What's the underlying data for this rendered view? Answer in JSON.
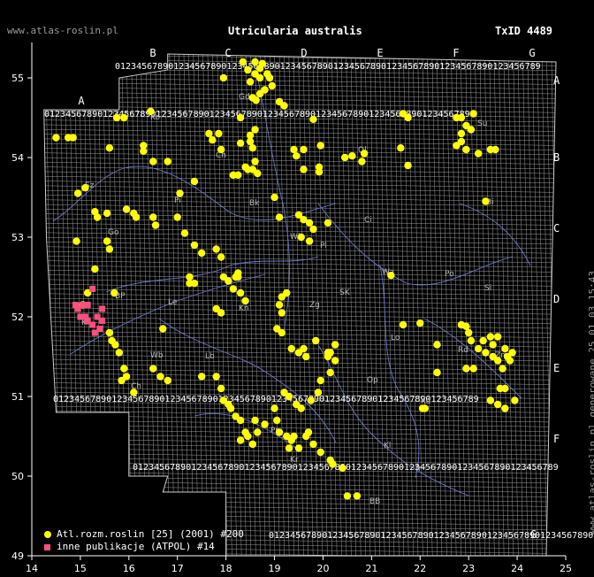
{
  "header": {
    "site": "www.atlas-roslin.pl",
    "title": "Utricularia australis",
    "taxid": "TxID 4489"
  },
  "side_text": "www.atlas-roslin.pl generowane 25.01.03 15:43",
  "legend": {
    "atlas_label": "Atl.rozm.roslin [25] (2001) #200",
    "atpol_label": "inne publikacje (ATPOL) #14"
  },
  "colors": {
    "atlas_dot": "#ffff00",
    "atpol_square": "#ff4f7f",
    "grid": "#ffffff",
    "rivers": "#6a78c8"
  },
  "axes": {
    "longitude_ticks": [
      "14",
      "15",
      "16",
      "17",
      "18",
      "19",
      "20",
      "21",
      "22",
      "23",
      "24",
      "25"
    ],
    "latitude_ticks": [
      "55",
      "54",
      "53",
      "52",
      "51",
      "50",
      "49"
    ]
  },
  "atpol": {
    "col_letters": [
      "A",
      "B",
      "C",
      "D",
      "E",
      "F",
      "G"
    ],
    "row_letters": [
      "A",
      "B",
      "C",
      "D",
      "E",
      "F",
      "G"
    ],
    "top_digits": "0123456789",
    "region_codes": [
      "Ko",
      "Gd",
      "El",
      "Su",
      "Ol",
      "Ch",
      "Bi",
      "Sz",
      "Pi",
      "Ci",
      "Wl",
      "Pl",
      "Go",
      "Wa",
      "Bk",
      "Po",
      "Le",
      "Kn",
      "SK",
      "Si",
      "BP",
      "Zg",
      "Lo",
      "Rd",
      "Lb",
      "Ch",
      "Wb",
      "Op",
      "Ka",
      "Kl",
      "Tr",
      "Kr",
      "BB",
      "NS",
      "Zm",
      "Ki",
      "Pr"
    ]
  },
  "atlas_points": [
    [
      14.5,
      54.25
    ],
    [
      14.75,
      54.25
    ],
    [
      14.85,
      54.25
    ],
    [
      14.95,
      53.55
    ],
    [
      15.1,
      53.62
    ],
    [
      15.6,
      54.12
    ],
    [
      15.75,
      54.5
    ],
    [
      15.9,
      54.5
    ],
    [
      16.45,
      54.58
    ],
    [
      16.3,
      54.15
    ],
    [
      16.3,
      54.08
    ],
    [
      16.5,
      53.95
    ],
    [
      16.8,
      53.95
    ],
    [
      17.05,
      53.55
    ],
    [
      17.35,
      53.7
    ],
    [
      17.65,
      54.3
    ],
    [
      17.72,
      54.22
    ],
    [
      17.85,
      54.3
    ],
    [
      17.9,
      54.1
    ],
    [
      17.95,
      55.0
    ],
    [
      18.15,
      53.78
    ],
    [
      18.25,
      53.78
    ],
    [
      18.3,
      54.5
    ],
    [
      18.5,
      54.28
    ],
    [
      18.45,
      53.85
    ],
    [
      18.55,
      54.12
    ],
    [
      18.6,
      53.95
    ],
    [
      18.4,
      53.88
    ],
    [
      18.55,
      53.85
    ],
    [
      18.65,
      53.8
    ],
    [
      18.3,
      54.18
    ],
    [
      18.5,
      54.2
    ],
    [
      18.6,
      54.35
    ],
    [
      18.55,
      54.75
    ],
    [
      18.7,
      54.8
    ],
    [
      18.62,
      54.72
    ],
    [
      18.8,
      54.85
    ],
    [
      18.7,
      55.12
    ],
    [
      18.7,
      55.0
    ],
    [
      18.6,
      55.05
    ],
    [
      18.45,
      55.1
    ],
    [
      18.5,
      54.95
    ],
    [
      18.35,
      55.2
    ],
    [
      18.6,
      55.2
    ],
    [
      18.75,
      55.18
    ],
    [
      18.85,
      55.05
    ],
    [
      18.9,
      55.0
    ],
    [
      18.95,
      54.9
    ],
    [
      19.1,
      54.7
    ],
    [
      19.2,
      54.65
    ],
    [
      19.8,
      54.48
    ],
    [
      19.4,
      54.1
    ],
    [
      19.45,
      54.02
    ],
    [
      19.6,
      54.1
    ],
    [
      19.95,
      54.15
    ],
    [
      19.92,
      53.88
    ],
    [
      19.92,
      53.82
    ],
    [
      19.6,
      53.85
    ],
    [
      19.0,
      53.5
    ],
    [
      19.1,
      53.25
    ],
    [
      19.5,
      53.28
    ],
    [
      19.6,
      53.22
    ],
    [
      19.72,
      53.18
    ],
    [
      19.8,
      53.1
    ],
    [
      20.1,
      53.18
    ],
    [
      19.55,
      53.0
    ],
    [
      19.72,
      52.95
    ],
    [
      20.45,
      54.0
    ],
    [
      20.6,
      54.02
    ],
    [
      20.8,
      53.95
    ],
    [
      20.85,
      54.05
    ],
    [
      21.6,
      54.12
    ],
    [
      21.65,
      54.55
    ],
    [
      21.75,
      54.5
    ],
    [
      21.75,
      53.9
    ],
    [
      22.75,
      54.5
    ],
    [
      22.85,
      54.5
    ],
    [
      22.95,
      54.4
    ],
    [
      23.1,
      54.55
    ],
    [
      23.05,
      54.35
    ],
    [
      22.85,
      54.3
    ],
    [
      22.85,
      54.2
    ],
    [
      22.75,
      54.15
    ],
    [
      22.95,
      54.1
    ],
    [
      23.2,
      54.05
    ],
    [
      23.35,
      53.45
    ],
    [
      23.45,
      54.1
    ],
    [
      23.55,
      54.1
    ],
    [
      15.3,
      53.32
    ],
    [
      15.35,
      53.25
    ],
    [
      15.55,
      53.3
    ],
    [
      15.95,
      53.35
    ],
    [
      16.1,
      53.3
    ],
    [
      16.15,
      53.25
    ],
    [
      16.5,
      53.25
    ],
    [
      16.55,
      53.15
    ],
    [
      17.0,
      53.25
    ],
    [
      17.15,
      53.05
    ],
    [
      17.35,
      52.9
    ],
    [
      17.5,
      52.8
    ],
    [
      17.8,
      52.85
    ],
    [
      17.9,
      52.75
    ],
    [
      17.95,
      52.5
    ],
    [
      18.2,
      52.5
    ],
    [
      18.25,
      52.5
    ],
    [
      18.05,
      52.45
    ],
    [
      18.25,
      52.55
    ],
    [
      18.15,
      52.35
    ],
    [
      18.3,
      52.3
    ],
    [
      18.4,
      52.2
    ],
    [
      17.25,
      52.5
    ],
    [
      17.25,
      52.42
    ],
    [
      17.35,
      52.42
    ],
    [
      17.8,
      52.1
    ],
    [
      17.9,
      52.05
    ],
    [
      15.55,
      52.95
    ],
    [
      15.6,
      52.85
    ],
    [
      14.92,
      52.95
    ],
    [
      15.3,
      52.6
    ],
    [
      15.15,
      52.3
    ],
    [
      15.05,
      52.15
    ],
    [
      15.7,
      52.3
    ],
    [
      16.7,
      51.85
    ],
    [
      15.6,
      51.8
    ],
    [
      15.65,
      51.7
    ],
    [
      15.72,
      51.65
    ],
    [
      15.8,
      51.55
    ],
    [
      15.9,
      51.35
    ],
    [
      15.95,
      51.25
    ],
    [
      15.85,
      51.2
    ],
    [
      16.1,
      51.05
    ],
    [
      16.5,
      51.35
    ],
    [
      16.65,
      51.25
    ],
    [
      16.8,
      51.2
    ],
    [
      17.5,
      51.25
    ],
    [
      17.8,
      51.25
    ],
    [
      17.9,
      51.1
    ],
    [
      17.95,
      50.95
    ],
    [
      18.05,
      50.9
    ],
    [
      18.1,
      50.85
    ],
    [
      18.2,
      50.75
    ],
    [
      18.3,
      50.7
    ],
    [
      18.4,
      50.55
    ],
    [
      18.3,
      50.45
    ],
    [
      18.45,
      50.5
    ],
    [
      18.55,
      50.4
    ],
    [
      18.65,
      50.55
    ],
    [
      18.6,
      50.7
    ],
    [
      18.8,
      50.65
    ],
    [
      19.0,
      50.85
    ],
    [
      19.05,
      50.7
    ],
    [
      19.1,
      50.55
    ],
    [
      19.25,
      50.5
    ],
    [
      19.35,
      50.45
    ],
    [
      19.3,
      50.35
    ],
    [
      19.4,
      50.5
    ],
    [
      19.5,
      50.35
    ],
    [
      19.65,
      50.5
    ],
    [
      19.7,
      50.55
    ],
    [
      19.8,
      50.4
    ],
    [
      19.95,
      50.3
    ],
    [
      20.15,
      50.2
    ],
    [
      20.2,
      50.15
    ],
    [
      20.4,
      50.1
    ],
    [
      19.2,
      51.05
    ],
    [
      19.3,
      51.0
    ],
    [
      19.45,
      50.9
    ],
    [
      19.55,
      50.85
    ],
    [
      19.75,
      50.95
    ],
    [
      19.9,
      51.05
    ],
    [
      19.95,
      51.2
    ],
    [
      20.15,
      51.3
    ],
    [
      20.1,
      51.5
    ],
    [
      20.15,
      51.55
    ],
    [
      20.25,
      51.45
    ],
    [
      19.35,
      51.6
    ],
    [
      19.5,
      51.55
    ],
    [
      19.6,
      51.6
    ],
    [
      19.65,
      51.5
    ],
    [
      19.15,
      51.8
    ],
    [
      19.05,
      51.85
    ],
    [
      19.15,
      52.05
    ],
    [
      19.1,
      52.15
    ],
    [
      19.15,
      52.25
    ],
    [
      19.25,
      52.3
    ],
    [
      19.85,
      51.7
    ],
    [
      20.1,
      51.55
    ],
    [
      20.25,
      51.65
    ],
    [
      21.4,
      52.52
    ],
    [
      21.65,
      51.9
    ],
    [
      22.0,
      51.92
    ],
    [
      22.35,
      51.65
    ],
    [
      22.35,
      51.3
    ],
    [
      22.85,
      51.9
    ],
    [
      22.95,
      51.88
    ],
    [
      23.0,
      51.8
    ],
    [
      23.05,
      51.7
    ],
    [
      23.2,
      51.6
    ],
    [
      23.35,
      51.55
    ],
    [
      23.5,
      51.5
    ],
    [
      23.6,
      51.45
    ],
    [
      23.7,
      51.35
    ],
    [
      23.8,
      51.5
    ],
    [
      23.9,
      51.55
    ],
    [
      23.85,
      51.45
    ],
    [
      23.5,
      51.65
    ],
    [
      23.75,
      51.6
    ],
    [
      23.3,
      51.7
    ],
    [
      23.45,
      51.75
    ],
    [
      23.6,
      51.75
    ],
    [
      23.65,
      51.1
    ],
    [
      23.75,
      51.1
    ],
    [
      23.45,
      50.95
    ],
    [
      23.6,
      50.9
    ],
    [
      23.75,
      50.85
    ],
    [
      23.95,
      50.95
    ],
    [
      22.05,
      50.85
    ],
    [
      22.1,
      50.85
    ],
    [
      20.5,
      49.75
    ],
    [
      20.7,
      49.75
    ],
    [
      23.1,
      51.35
    ],
    [
      22.95,
      51.35
    ]
  ],
  "atpol_points": [
    [
      14.9,
      52.15
    ],
    [
      14.95,
      52.1
    ],
    [
      15.05,
      52.15
    ],
    [
      15.15,
      52.15
    ],
    [
      15.0,
      52.0
    ],
    [
      15.1,
      52.0
    ],
    [
      15.25,
      51.9
    ],
    [
      15.3,
      51.8
    ],
    [
      15.35,
      52.0
    ],
    [
      15.45,
      51.95
    ],
    [
      15.25,
      52.35
    ],
    [
      15.45,
      52.1
    ],
    [
      15.15,
      51.95
    ],
    [
      15.4,
      51.85
    ]
  ]
}
